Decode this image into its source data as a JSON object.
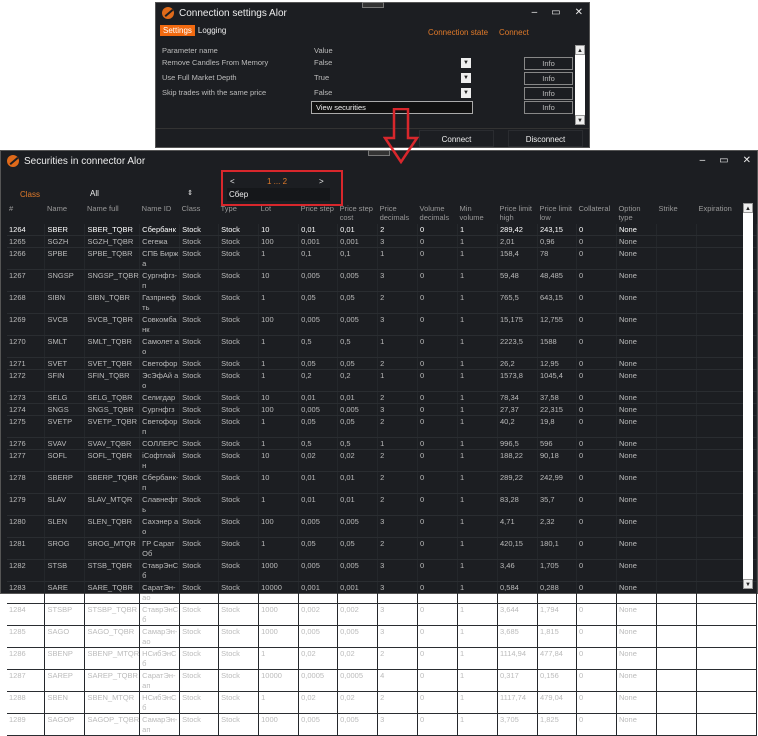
{
  "conn": {
    "title": "Connection settings Alor",
    "tabs": [
      "Settings",
      "Logging"
    ],
    "state_label": "Connection state",
    "state_value": "Connect",
    "header": {
      "param": "Parameter name",
      "value": "Value"
    },
    "params": [
      {
        "name": "Remove Candles From Memory",
        "value": "False"
      },
      {
        "name": "Use Full Market Depth",
        "value": "True"
      },
      {
        "name": "Skip trades with the same price",
        "value": "False"
      }
    ],
    "view_securities": "View securities",
    "info": "Info",
    "connect": "Connect",
    "disconnect": "Disconnect"
  },
  "sec": {
    "title": "Securities in connector  Alor",
    "class_label": "Class",
    "class_value": "All",
    "page_prev": "<",
    "page_next": ">",
    "pages": "1 ... 2",
    "search_value": "Сбер",
    "columns": [
      "#",
      "Name",
      "Name full",
      "Name ID",
      "Class",
      "Type",
      "Lot",
      "Price step",
      "Price step cost",
      "Price decimals",
      "Volume decimals",
      "Min volume",
      "Price limit high",
      "Price limit low",
      "Collateral",
      "Option type",
      "Strike",
      "Expiration"
    ],
    "rows": [
      [
        "1264",
        "SBER",
        "SBER_TQBR",
        "Сбербанк",
        "Stock",
        "Stock",
        "10",
        "0,01",
        "0,01",
        "2",
        "0",
        "1",
        "289,42",
        "243,15",
        "0",
        "None",
        "",
        ""
      ],
      [
        "1265",
        "SGZH",
        "SGZH_TQBR",
        "Сегежа",
        "Stock",
        "Stock",
        "100",
        "0,001",
        "0,001",
        "3",
        "0",
        "1",
        "2,01",
        "0,96",
        "0",
        "None",
        "",
        ""
      ],
      [
        "1266",
        "SPBE",
        "SPBE_TQBR",
        "СПБ Биржа",
        "Stock",
        "Stock",
        "1",
        "0,1",
        "0,1",
        "1",
        "0",
        "1",
        "158,4",
        "78",
        "0",
        "None",
        "",
        ""
      ],
      [
        "1267",
        "SNGSP",
        "SNGSP_TQBR",
        "Сургнфгз-п",
        "Stock",
        "Stock",
        "10",
        "0,005",
        "0,005",
        "3",
        "0",
        "1",
        "59,48",
        "48,485",
        "0",
        "None",
        "",
        ""
      ],
      [
        "1268",
        "SIBN",
        "SIBN_TQBR",
        "Газпрнефть",
        "Stock",
        "Stock",
        "1",
        "0,05",
        "0,05",
        "2",
        "0",
        "1",
        "765,5",
        "643,15",
        "0",
        "None",
        "",
        ""
      ],
      [
        "1269",
        "SVCB",
        "SVCB_TQBR",
        "Совкомбанк",
        "Stock",
        "Stock",
        "100",
        "0,005",
        "0,005",
        "3",
        "0",
        "1",
        "15,175",
        "12,755",
        "0",
        "None",
        "",
        ""
      ],
      [
        "1270",
        "SMLT",
        "SMLT_TQBR",
        "Самолет ао",
        "Stock",
        "Stock",
        "1",
        "0,5",
        "0,5",
        "1",
        "0",
        "1",
        "2223,5",
        "1588",
        "0",
        "None",
        "",
        ""
      ],
      [
        "1271",
        "SVET",
        "SVET_TQBR",
        "Светофор",
        "Stock",
        "Stock",
        "1",
        "0,05",
        "0,05",
        "2",
        "0",
        "1",
        "26,2",
        "12,95",
        "0",
        "None",
        "",
        ""
      ],
      [
        "1272",
        "SFIN",
        "SFIN_TQBR",
        "ЭсЭфАй ао",
        "Stock",
        "Stock",
        "1",
        "0,2",
        "0,2",
        "1",
        "0",
        "1",
        "1573,8",
        "1045,4",
        "0",
        "None",
        "",
        ""
      ],
      [
        "1273",
        "SELG",
        "SELG_TQBR",
        "Селигдар",
        "Stock",
        "Stock",
        "10",
        "0,01",
        "0,01",
        "2",
        "0",
        "1",
        "78,34",
        "37,58",
        "0",
        "None",
        "",
        ""
      ],
      [
        "1274",
        "SNGS",
        "SNGS_TQBR",
        "Сургнфгз",
        "Stock",
        "Stock",
        "100",
        "0,005",
        "0,005",
        "3",
        "0",
        "1",
        "27,37",
        "22,315",
        "0",
        "None",
        "",
        ""
      ],
      [
        "1275",
        "SVETP",
        "SVETP_TQBR",
        "Светофор п",
        "Stock",
        "Stock",
        "1",
        "0,05",
        "0,05",
        "2",
        "0",
        "1",
        "40,2",
        "19,8",
        "0",
        "None",
        "",
        ""
      ],
      [
        "1276",
        "SVAV",
        "SVAV_TQBR",
        "СОЛЛЕРС",
        "Stock",
        "Stock",
        "1",
        "0,5",
        "0,5",
        "1",
        "0",
        "1",
        "996,5",
        "596",
        "0",
        "None",
        "",
        ""
      ],
      [
        "1277",
        "SOFL",
        "SOFL_TQBR",
        "iСофтлайн",
        "Stock",
        "Stock",
        "10",
        "0,02",
        "0,02",
        "2",
        "0",
        "1",
        "188,22",
        "90,18",
        "0",
        "None",
        "",
        ""
      ],
      [
        "1278",
        "SBERP",
        "SBERP_TQBR",
        "Сбербанк-п",
        "Stock",
        "Stock",
        "10",
        "0,01",
        "0,01",
        "2",
        "0",
        "1",
        "289,22",
        "242,99",
        "0",
        "None",
        "",
        ""
      ],
      [
        "1279",
        "SLAV",
        "SLAV_MTQR",
        "Славнефть",
        "Stock",
        "Stock",
        "1",
        "0,01",
        "0,01",
        "2",
        "0",
        "1",
        "83,28",
        "35,7",
        "0",
        "None",
        "",
        ""
      ],
      [
        "1280",
        "SLEN",
        "SLEN_TQBR",
        "Сахэнер ао",
        "Stock",
        "Stock",
        "100",
        "0,005",
        "0,005",
        "3",
        "0",
        "1",
        "4,71",
        "2,32",
        "0",
        "None",
        "",
        ""
      ],
      [
        "1281",
        "SROG",
        "SROG_MTQR",
        "ГР СаратОб",
        "Stock",
        "Stock",
        "1",
        "0,05",
        "0,05",
        "2",
        "0",
        "1",
        "420,15",
        "180,1",
        "0",
        "None",
        "",
        ""
      ],
      [
        "1282",
        "STSB",
        "STSB_TQBR",
        "СтаврЭнСб",
        "Stock",
        "Stock",
        "1000",
        "0,005",
        "0,005",
        "3",
        "0",
        "1",
        "3,46",
        "1,705",
        "0",
        "None",
        "",
        ""
      ],
      [
        "1283",
        "SARE",
        "SARE_TQBR",
        "СаратЭн-ао",
        "Stock",
        "Stock",
        "10000",
        "0,001",
        "0,001",
        "3",
        "0",
        "1",
        "0,584",
        "0,288",
        "0",
        "None",
        "",
        ""
      ],
      [
        "1284",
        "STSBP",
        "STSBP_TQBR",
        "СтаврЭнСб",
        "Stock",
        "Stock",
        "1000",
        "0,002",
        "0,002",
        "3",
        "0",
        "1",
        "3,644",
        "1,794",
        "0",
        "None",
        "",
        ""
      ],
      [
        "1285",
        "SAGO",
        "SAGO_TQBR",
        "СамарЭн-ао",
        "Stock",
        "Stock",
        "1000",
        "0,005",
        "0,005",
        "3",
        "0",
        "1",
        "3,685",
        "1,815",
        "0",
        "None",
        "",
        ""
      ],
      [
        "1286",
        "SBENP",
        "SBENP_MTQR",
        "НСибЭнСб",
        "Stock",
        "Stock",
        "1",
        "0,02",
        "0,02",
        "2",
        "0",
        "1",
        "1114,94",
        "477,84",
        "0",
        "None",
        "",
        ""
      ],
      [
        "1287",
        "SAREP",
        "SAREP_TQBR",
        "СаратЭн-ап",
        "Stock",
        "Stock",
        "10000",
        "0,0005",
        "0,0005",
        "4",
        "0",
        "1",
        "0,317",
        "0,156",
        "0",
        "None",
        "",
        ""
      ],
      [
        "1288",
        "SBEN",
        "SBEN_MTQR",
        "НСибЭнСб",
        "Stock",
        "Stock",
        "1",
        "0,02",
        "0,02",
        "2",
        "0",
        "1",
        "1117,74",
        "479,04",
        "0",
        "None",
        "",
        ""
      ],
      [
        "1289",
        "SAGOP",
        "SAGOP_TQBR",
        "СамарЭн-ап",
        "Stock",
        "Stock",
        "1000",
        "0,005",
        "0,005",
        "3",
        "0",
        "1",
        "3,705",
        "1,825",
        "0",
        "None",
        "",
        ""
      ]
    ]
  },
  "colors": {
    "accent": "#f26a10",
    "highlight": "#d8272c",
    "bg": "#1c1e22"
  }
}
